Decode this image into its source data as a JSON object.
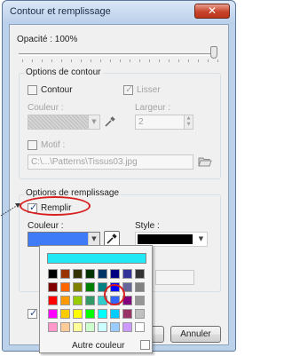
{
  "window": {
    "title": "Contour et remplissage",
    "close_glyph": "✕"
  },
  "opacity": {
    "label": "Opacité : 100%",
    "value_percent": 100
  },
  "stroke_options": {
    "group_title": "Options de contour",
    "contour": {
      "label": "Contour",
      "checked": false
    },
    "smooth": {
      "label": "Lisser",
      "checked": true,
      "enabled": false
    },
    "color_label": "Couleur :",
    "width_label": "Largeur :",
    "width_value": "2",
    "pattern": {
      "label": "Motif :",
      "checked": false
    },
    "pattern_path": "C:\\...\\Patterns\\Tissus03.jpg"
  },
  "fill_options": {
    "group_title": "Options de remplissage",
    "fill": {
      "label": "Remplir",
      "checked": true
    },
    "color_label": "Couleur :",
    "style_label": "Style :",
    "selected_color": "#3f7af7",
    "style_color": "#000000"
  },
  "palette": {
    "current_color": "#22e8f5",
    "rows": [
      [
        "#000000",
        "#993300",
        "#333300",
        "#003300",
        "#003366",
        "#000080",
        "#333399",
        "#333333"
      ],
      [
        "#800000",
        "#ff6600",
        "#808000",
        "#008000",
        "#008080",
        "#0000ff",
        "#666699",
        "#808080"
      ],
      [
        "#ff0000",
        "#ff9900",
        "#99cc00",
        "#339966",
        "#33cccc",
        "#3366ff",
        "#800080",
        "#969696"
      ],
      [
        "#ff00ff",
        "#ffcc00",
        "#ffff00",
        "#00ff00",
        "#00ffff",
        "#00ccff",
        "#993366",
        "#c0c0c0"
      ],
      [
        "#ff99cc",
        "#ffcc99",
        "#ffff99",
        "#ccffcc",
        "#ccffff",
        "#99ccff",
        "#cc99ff",
        "#ffffff"
      ]
    ],
    "other_color_label": "Autre couleur"
  },
  "buttons": {
    "cancel_label": "Annuler"
  },
  "colors": {
    "highlight_red": "#d81e1e",
    "window_border": "#5d7a9c"
  },
  "icons": {
    "eyedropper": "eyedropper-icon",
    "folder": "folder-icon"
  }
}
